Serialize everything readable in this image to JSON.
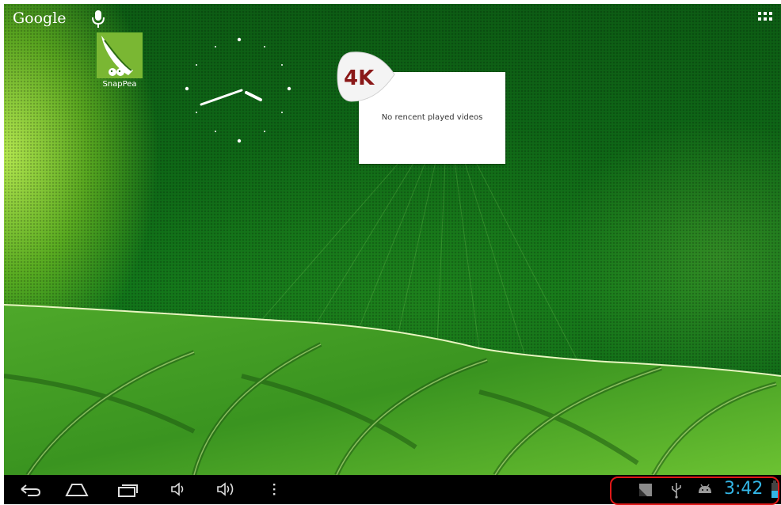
{
  "search": {
    "label": "Google"
  },
  "app_icons": [
    {
      "label": "SnapPea"
    }
  ],
  "video_widget": {
    "badge": "4K",
    "message": "No rencent played videos"
  },
  "status_bar": {
    "time": "3:42"
  },
  "nav": {
    "buttons": [
      "back",
      "home",
      "recent-apps",
      "volume-down",
      "volume-up",
      "menu"
    ]
  },
  "colors": {
    "clock_time": "#33b5e5",
    "highlight_border": "#e01818",
    "wallpaper": "#0f6a17"
  }
}
